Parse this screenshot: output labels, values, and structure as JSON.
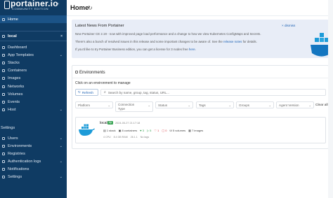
{
  "sidebar": {
    "brand": "portainer.io",
    "edition": "COMMUNITY EDITION",
    "home_label": "Home",
    "environment_name": "local",
    "env_items": [
      {
        "label": "Dashboard"
      },
      {
        "label": "App Templates"
      },
      {
        "label": "Stacks"
      },
      {
        "label": "Containers"
      },
      {
        "label": "Images"
      },
      {
        "label": "Networks"
      },
      {
        "label": "Volumes"
      },
      {
        "label": "Events"
      },
      {
        "label": "Host"
      }
    ],
    "settings_section": "Settings",
    "settings_items": [
      {
        "label": "Users"
      },
      {
        "label": "Environments"
      },
      {
        "label": "Registries"
      },
      {
        "label": "Authentication logs"
      },
      {
        "label": "Notifications"
      },
      {
        "label": "Settings"
      }
    ]
  },
  "header": {
    "title": "Home"
  },
  "news": {
    "title": "Latest News From Portainer",
    "dismiss": "× dismiss",
    "line1": "New Portainer CE 2.19 - now with improved page load performance and a change to how we view Kubernetes ConfigMaps and Secrets.",
    "line2_pre": "There's also a bunch of resolved issues in this release and some important changes to be aware of. See the ",
    "line2_link": "release notes",
    "line2_post": " for details.",
    "line3_pre": "If you'd like to try Portainer Business edition, you can get a license for 3 nodes free ",
    "line3_link": "here",
    "line3_post": "."
  },
  "environments": {
    "title": "Environments",
    "subtitle": "Click on an environment to manage",
    "refresh_label": "Refresh",
    "search_placeholder": "Search by name, group, tag, status, URL...",
    "filters": [
      "Platform",
      "Connection Type",
      "Status",
      "Tags",
      "Groups",
      "Agent Version"
    ],
    "clear_all": "Clear all",
    "card": {
      "name": "local",
      "status": "Up",
      "timestamp": "2024-05-27 21:17:18",
      "stacks": "1 stack",
      "containers": "8 containers",
      "healthy": "3",
      "running": "5",
      "unhealthy": "1",
      "stopped": "0",
      "volumes": "5 volumes",
      "images": "7 images",
      "cpu": "4 CPU",
      "memory": "8.4 GB RAM",
      "version": "26.1.1",
      "tags": "No tags"
    }
  },
  "colors": {
    "sidebar_bg": "#0f3b63",
    "active_bg": "#1b5387",
    "news_bg": "#e8edf7",
    "link": "#1f63b4",
    "up_green": "#3ca556"
  }
}
